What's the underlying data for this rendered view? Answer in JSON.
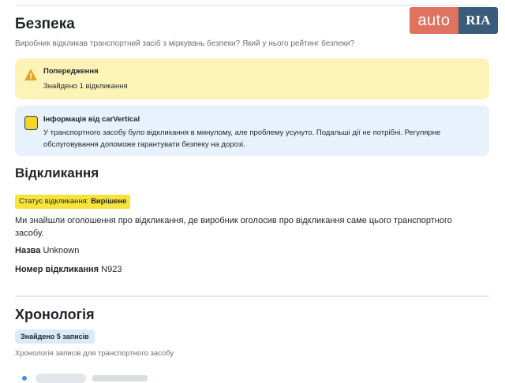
{
  "logo": {
    "part1": "auto",
    "part2": "RIA"
  },
  "safety": {
    "title": "Безпека",
    "subtitle": "Виробник відкликав транспортний засіб з міркувань безпеки? Який у нього рейтинг безпеки?",
    "warning": {
      "title": "Попередження",
      "text": "Знайдено 1 відкликання",
      "icon": "warning-triangle-icon"
    },
    "info": {
      "title": "Інформація від carVertical",
      "text": "У транспортного засобу було відкликання в минулому, але проблему усунуто. Подальші дії не потрібні. Регулярне обслуговування допоможе гарантувати безпеку на дорозі.",
      "icon": "carvertical-logo-icon"
    }
  },
  "recalls": {
    "title": "Відкликання",
    "status_label": "Статус відкликання:",
    "status_value": "Вирішене",
    "description": "Ми знайшли оголошення про відкликання, де виробник оголосив про відкликання саме цього транспортного засобу.",
    "name_label": "Назва",
    "name_value": "Unknown",
    "number_label": "Номер відкликання",
    "number_value": "N923"
  },
  "chronology": {
    "title": "Хронологія",
    "badge": "Знайдено 5 записів",
    "subtitle": "Хронологія записів для транспортного засобу"
  },
  "colors": {
    "warn_bg": "#fdf3b6",
    "info_bg": "#e8f2fc",
    "status_badge": "#f7e43a",
    "count_badge": "#dbeafb"
  }
}
